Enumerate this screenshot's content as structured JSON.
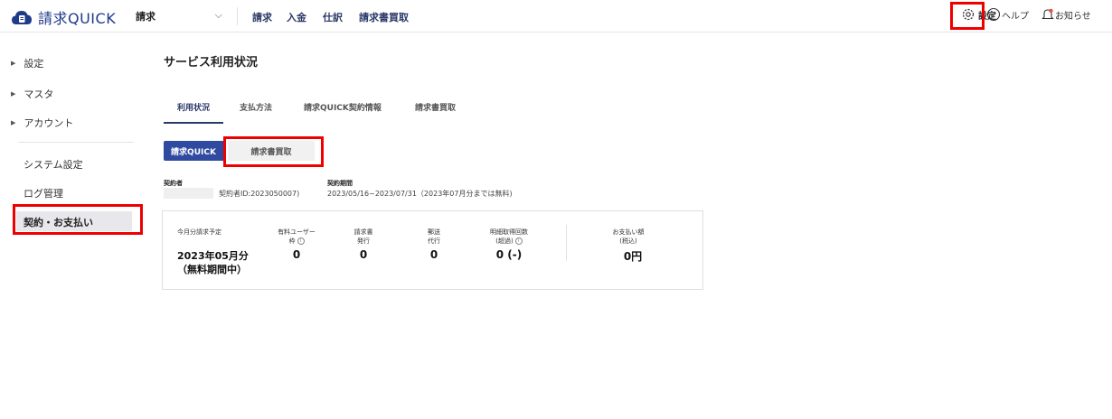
{
  "header": {
    "logo_text": "請求QUICK",
    "product_select": "請求",
    "nav": [
      "請求",
      "入金",
      "仕訳",
      "請求書買取"
    ],
    "settings_label": "設定",
    "help_label": "ヘルプ",
    "notice_label": "お知らせ"
  },
  "sidebar": {
    "groups": [
      "設定",
      "マスタ",
      "アカウント"
    ],
    "subitems": [
      "システム設定",
      "ログ管理"
    ],
    "active_item": "契約・お支払い"
  },
  "main": {
    "title": "サービス利用状況",
    "tabs": [
      "利用状況",
      "支払方法",
      "請求QUICK契約情報",
      "請求書買取"
    ],
    "segments": [
      "請求QUICK",
      "請求書買取"
    ],
    "contractor_label": "契約者",
    "contractor_id": "契約者ID:2023050007)",
    "period_label": "契約期間",
    "period_value": "2023/05/16~2023/07/31（2023年07月分までは無料)"
  },
  "card": {
    "month_label": "今月分請求予定",
    "month_value": "2023年05月分",
    "month_note": "（無料期間中）",
    "columns": [
      {
        "label1": "有料ユーザー",
        "label2": "枠",
        "value": "0"
      },
      {
        "label1": "請求書",
        "label2": "発行",
        "value": "0"
      },
      {
        "label1": "郵送",
        "label2": "代行",
        "value": "0"
      },
      {
        "label1": "明細取得回数",
        "label2": "(超過)",
        "value": "0 (-)"
      }
    ],
    "payment_label1": "お支払い額",
    "payment_label2": "(税込)",
    "payment_value": "0円"
  },
  "colors": {
    "brand": "#1e3a8a",
    "accent": "#2f4aa0",
    "highlight": "#e00000"
  }
}
